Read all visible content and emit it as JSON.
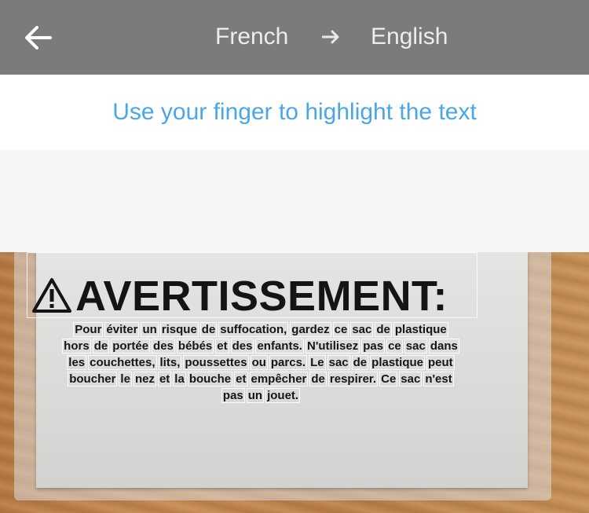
{
  "header": {
    "source_language": "French",
    "target_language": "English",
    "back_icon": "arrow-left-icon",
    "swap_icon": "arrow-right-icon"
  },
  "hint": {
    "text": "Use your finger to highlight the text"
  },
  "photo": {
    "headline": "AVERTISSEMENT:",
    "warning_icon": "warning-triangle-icon",
    "words": [
      [
        "Pour",
        "éviter",
        "un",
        "risque",
        "de",
        "suffocation,",
        "gardez",
        "ce",
        "sac",
        "de",
        "plastique"
      ],
      [
        "hors",
        "de",
        "portée",
        "des",
        "bébés",
        "et",
        "des",
        "enfants.",
        "N'utilisez",
        "pas",
        "ce",
        "sac",
        "dans"
      ],
      [
        "les",
        "couchettes,",
        "lits,",
        "poussettes",
        "ou",
        "parcs.",
        "Le",
        "sac",
        "de",
        "plastique",
        "peut"
      ],
      [
        "boucher",
        "le",
        "nez",
        "et",
        "la",
        "bouche",
        "et",
        "empêcher",
        "de",
        "respirer.",
        "Ce",
        "sac",
        "n'est"
      ],
      [
        "pas",
        "un",
        "jouet."
      ]
    ]
  },
  "colors": {
    "header_bg": "#7b7b7b",
    "hint_text": "#4aa7e6"
  }
}
